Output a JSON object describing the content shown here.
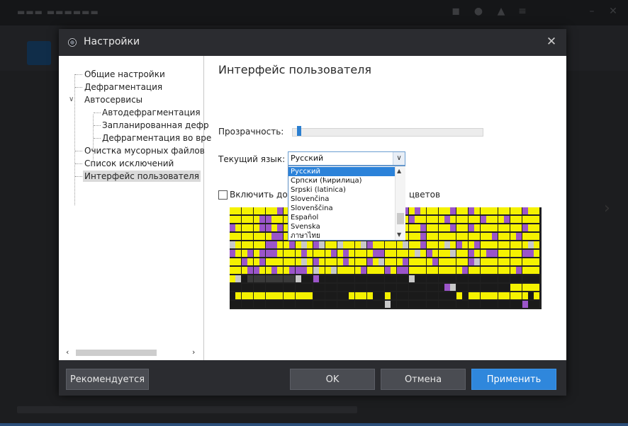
{
  "dialog": {
    "title": "Настройки",
    "close_icon": "close-icon",
    "app_icon": "defrag-app-icon"
  },
  "tree": {
    "items": [
      {
        "label": "Общие настройки",
        "level": 0,
        "selected": false
      },
      {
        "label": "Дефрагментация",
        "level": 0,
        "selected": false
      },
      {
        "label": "Автосервисы",
        "level": 0,
        "selected": false,
        "expanded": true
      },
      {
        "label": "Автодефрагментация",
        "level": 1,
        "selected": false
      },
      {
        "label": "Запланированная дефр",
        "level": 1,
        "selected": false
      },
      {
        "label": "Дефрагментация во вре",
        "level": 1,
        "selected": false
      },
      {
        "label": "Очистка мусорных файлов",
        "level": 0,
        "selected": false
      },
      {
        "label": "Список исключений",
        "level": 0,
        "selected": false
      },
      {
        "label": "Интерфейс пользователя",
        "level": 0,
        "selected": true
      }
    ],
    "scroll_left_icon": "‹",
    "scroll_right_icon": "›"
  },
  "content": {
    "title": "Интерфейс пользователя",
    "transparency_label": "Прозрачность:",
    "transparency_value": 0.02,
    "language_label": "Текущий язык:",
    "language_value": "Русский",
    "checkbox_label_left": "Включить дост",
    "checkbox_label_right": "цветов",
    "checkbox_checked": false
  },
  "language_dropdown": {
    "options": [
      "Русский",
      "Српски (ћирилица)",
      "Srpski (latinica)",
      "Slovenčina",
      "Slovenščina",
      "Español",
      "Svenska",
      "ภาษาไทย"
    ],
    "selected_index": 0
  },
  "disk_map": {
    "colors": {
      "Y": "#f5f200",
      "P": "#9b55c9",
      "G": "#c8c8c8",
      "D": "#3a3a3a",
      "K": "#1a1a1a"
    },
    "rows": [
      "YYYYYYYYPYYYYPYYPYYYYPYYYYYYYPYPYYYYYPYYPYYYYYYYYPYY",
      "YYYYYPPYYYYYPYYYPYYYYPYYYYYYYYPYYYYYPYYYYYPYYYPYYYYY",
      "PYYYYPPYPYYYYYPYYYYYPYYYYYYYYYYYPYYYYPYYPYYYYYYYYPYY",
      "YYYYYYYPPYPYYPYYYYPYYYPYPYYPYYYYPYYYYYYYYYYYPYYYPYYY",
      "GYYYYYPPYYPYGYPGYYGYYYGPYYYYYGYYPYYYGYPYYPYYYYYYYYGY",
      "PYYPYPPPYYYYPYYYYPYPYYYYPPYYYYYGYPYYYGYYPYYPPYYYYPPY",
      "YYPYYPYYYYYYGYPYYYYPYYYPYGYYYPYYYYPYYYYYPGYYYYYYYYYY",
      "YYYPPYYPYYPPPYGYYGYYYYPYYYPYPPYYYYYYYYYPYYYYYYYYPYYY",
      "YGKDDDDDDDDGKKPKKKKKKKKKKKKKKKGKKKKKKKKKKKKKKKKKKKKK",
      "KKKKKKKKKKKKKKKKKKKKKKKKKKKKKKKKKKKKPGKKKKKKKKKYYYYY",
      "KYYYYYYYYYYYYYKKKKKKYYYYKKYKKKKKKKKKKKYKYYYYYYYYYYKY",
      "KKKKKKKKKKKKKKKKKKKKKKKKKKGKKKKKKKKKKKKKKKKKKKKKKPKK"
    ]
  },
  "footer": {
    "recommended_label": "Рекомендуется",
    "ok_label": "OK",
    "cancel_label": "Отмена",
    "apply_label": "Применить"
  }
}
